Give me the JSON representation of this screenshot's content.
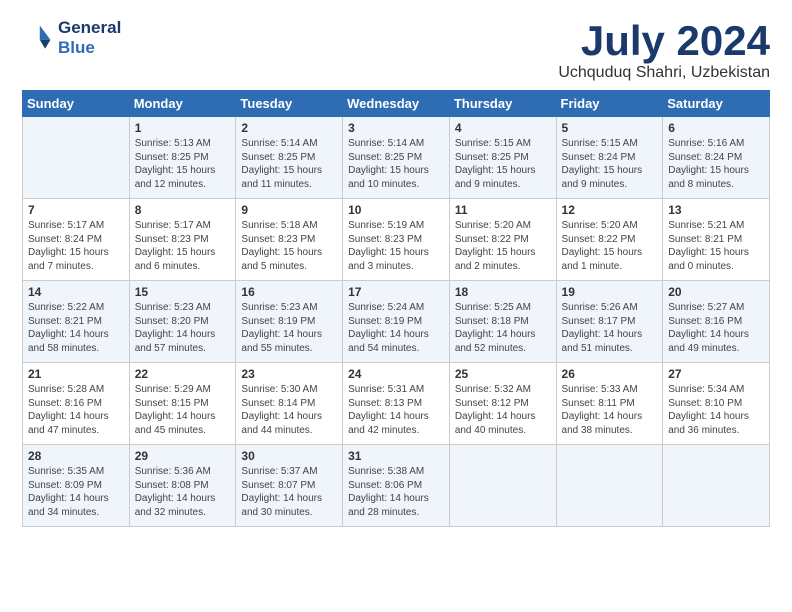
{
  "header": {
    "logo_line1": "General",
    "logo_line2": "Blue",
    "month": "July 2024",
    "location": "Uchquduq Shahri, Uzbekistan"
  },
  "days_of_week": [
    "Sunday",
    "Monday",
    "Tuesday",
    "Wednesday",
    "Thursday",
    "Friday",
    "Saturday"
  ],
  "weeks": [
    [
      {
        "day": "",
        "info": ""
      },
      {
        "day": "1",
        "info": "Sunrise: 5:13 AM\nSunset: 8:25 PM\nDaylight: 15 hours\nand 12 minutes."
      },
      {
        "day": "2",
        "info": "Sunrise: 5:14 AM\nSunset: 8:25 PM\nDaylight: 15 hours\nand 11 minutes."
      },
      {
        "day": "3",
        "info": "Sunrise: 5:14 AM\nSunset: 8:25 PM\nDaylight: 15 hours\nand 10 minutes."
      },
      {
        "day": "4",
        "info": "Sunrise: 5:15 AM\nSunset: 8:25 PM\nDaylight: 15 hours\nand 9 minutes."
      },
      {
        "day": "5",
        "info": "Sunrise: 5:15 AM\nSunset: 8:24 PM\nDaylight: 15 hours\nand 9 minutes."
      },
      {
        "day": "6",
        "info": "Sunrise: 5:16 AM\nSunset: 8:24 PM\nDaylight: 15 hours\nand 8 minutes."
      }
    ],
    [
      {
        "day": "7",
        "info": "Sunrise: 5:17 AM\nSunset: 8:24 PM\nDaylight: 15 hours\nand 7 minutes."
      },
      {
        "day": "8",
        "info": "Sunrise: 5:17 AM\nSunset: 8:23 PM\nDaylight: 15 hours\nand 6 minutes."
      },
      {
        "day": "9",
        "info": "Sunrise: 5:18 AM\nSunset: 8:23 PM\nDaylight: 15 hours\nand 5 minutes."
      },
      {
        "day": "10",
        "info": "Sunrise: 5:19 AM\nSunset: 8:23 PM\nDaylight: 15 hours\nand 3 minutes."
      },
      {
        "day": "11",
        "info": "Sunrise: 5:20 AM\nSunset: 8:22 PM\nDaylight: 15 hours\nand 2 minutes."
      },
      {
        "day": "12",
        "info": "Sunrise: 5:20 AM\nSunset: 8:22 PM\nDaylight: 15 hours\nand 1 minute."
      },
      {
        "day": "13",
        "info": "Sunrise: 5:21 AM\nSunset: 8:21 PM\nDaylight: 15 hours\nand 0 minutes."
      }
    ],
    [
      {
        "day": "14",
        "info": "Sunrise: 5:22 AM\nSunset: 8:21 PM\nDaylight: 14 hours\nand 58 minutes."
      },
      {
        "day": "15",
        "info": "Sunrise: 5:23 AM\nSunset: 8:20 PM\nDaylight: 14 hours\nand 57 minutes."
      },
      {
        "day": "16",
        "info": "Sunrise: 5:23 AM\nSunset: 8:19 PM\nDaylight: 14 hours\nand 55 minutes."
      },
      {
        "day": "17",
        "info": "Sunrise: 5:24 AM\nSunset: 8:19 PM\nDaylight: 14 hours\nand 54 minutes."
      },
      {
        "day": "18",
        "info": "Sunrise: 5:25 AM\nSunset: 8:18 PM\nDaylight: 14 hours\nand 52 minutes."
      },
      {
        "day": "19",
        "info": "Sunrise: 5:26 AM\nSunset: 8:17 PM\nDaylight: 14 hours\nand 51 minutes."
      },
      {
        "day": "20",
        "info": "Sunrise: 5:27 AM\nSunset: 8:16 PM\nDaylight: 14 hours\nand 49 minutes."
      }
    ],
    [
      {
        "day": "21",
        "info": "Sunrise: 5:28 AM\nSunset: 8:16 PM\nDaylight: 14 hours\nand 47 minutes."
      },
      {
        "day": "22",
        "info": "Sunrise: 5:29 AM\nSunset: 8:15 PM\nDaylight: 14 hours\nand 45 minutes."
      },
      {
        "day": "23",
        "info": "Sunrise: 5:30 AM\nSunset: 8:14 PM\nDaylight: 14 hours\nand 44 minutes."
      },
      {
        "day": "24",
        "info": "Sunrise: 5:31 AM\nSunset: 8:13 PM\nDaylight: 14 hours\nand 42 minutes."
      },
      {
        "day": "25",
        "info": "Sunrise: 5:32 AM\nSunset: 8:12 PM\nDaylight: 14 hours\nand 40 minutes."
      },
      {
        "day": "26",
        "info": "Sunrise: 5:33 AM\nSunset: 8:11 PM\nDaylight: 14 hours\nand 38 minutes."
      },
      {
        "day": "27",
        "info": "Sunrise: 5:34 AM\nSunset: 8:10 PM\nDaylight: 14 hours\nand 36 minutes."
      }
    ],
    [
      {
        "day": "28",
        "info": "Sunrise: 5:35 AM\nSunset: 8:09 PM\nDaylight: 14 hours\nand 34 minutes."
      },
      {
        "day": "29",
        "info": "Sunrise: 5:36 AM\nSunset: 8:08 PM\nDaylight: 14 hours\nand 32 minutes."
      },
      {
        "day": "30",
        "info": "Sunrise: 5:37 AM\nSunset: 8:07 PM\nDaylight: 14 hours\nand 30 minutes."
      },
      {
        "day": "31",
        "info": "Sunrise: 5:38 AM\nSunset: 8:06 PM\nDaylight: 14 hours\nand 28 minutes."
      },
      {
        "day": "",
        "info": ""
      },
      {
        "day": "",
        "info": ""
      },
      {
        "day": "",
        "info": ""
      }
    ]
  ]
}
